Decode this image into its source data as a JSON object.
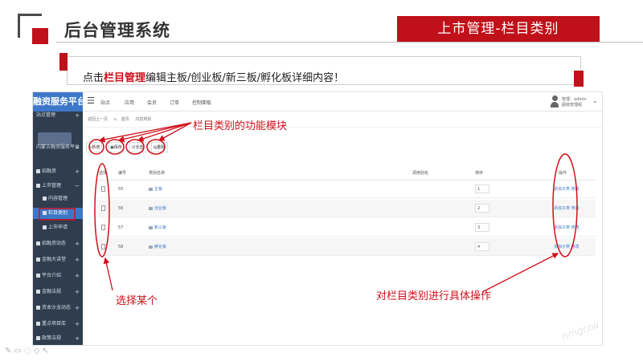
{
  "slide": {
    "title": "后台管理系统",
    "tag": "上市管理-栏目类别",
    "instruction": {
      "prefix": "点击",
      "highlight": "栏目管理",
      "suffix": "编辑主板/创业板/新三板/孵化板详细内容！"
    },
    "watermark": "nmgrzw"
  },
  "app": {
    "brand": "融资服务平台",
    "topbar": {
      "tabs": [
        "站点",
        "应用",
        "会员",
        "订单",
        "控制面板"
      ],
      "user_line1": "管理：admin",
      "user_line2": "超级管理组"
    },
    "sidebar": {
      "items": [
        {
          "label": "站点管理",
          "state": "section"
        },
        {
          "label": "内蒙古融资服务平台",
          "state": "section"
        },
        {
          "label": "招融资",
          "state": "normal"
        },
        {
          "label": "上市管理",
          "state": "expanded"
        },
        {
          "label": "内容管理",
          "state": "sub"
        },
        {
          "label": "栏目类别",
          "state": "active"
        },
        {
          "label": "上市申请",
          "state": "sub"
        },
        {
          "label": "招融资动态",
          "state": "normal"
        },
        {
          "label": "金融大讲堂",
          "state": "normal"
        },
        {
          "label": "平台介绍",
          "state": "normal"
        },
        {
          "label": "金融法规",
          "state": "normal"
        },
        {
          "label": "资本沙龙动态",
          "state": "normal"
        },
        {
          "label": "重点项目库",
          "state": "normal"
        },
        {
          "label": "政策法规",
          "state": "normal"
        }
      ]
    },
    "breadcrumb": [
      "返回上一页",
      "首页",
      "内容类别"
    ],
    "toolbar": [
      "新增",
      "保存",
      "全选",
      "删除"
    ],
    "table": {
      "columns": [
        "选择",
        "编号",
        "类别名称",
        "调用别名",
        "排序",
        "操作"
      ],
      "rows": [
        {
          "id": "55",
          "name": "主板",
          "sort": "1",
          "ops": "添加子类 修改"
        },
        {
          "id": "56",
          "name": "创业板",
          "sort": "2",
          "ops": "添加子类 修改"
        },
        {
          "id": "57",
          "name": "新三板",
          "sort": "3",
          "ops": "添加子类 修改"
        },
        {
          "id": "58",
          "name": "孵化板",
          "sort": "4",
          "ops": "添加子类 修改"
        }
      ]
    }
  },
  "annotations": {
    "toolbar_note": "栏目类别的功能模块",
    "select_note": "选择某个",
    "ops_note": "对栏目类别进行具体操作"
  },
  "colors": {
    "accent_red": "#c0101a",
    "brand_blue": "#3d78c8",
    "sidebar_bg": "#2f3d4f"
  }
}
